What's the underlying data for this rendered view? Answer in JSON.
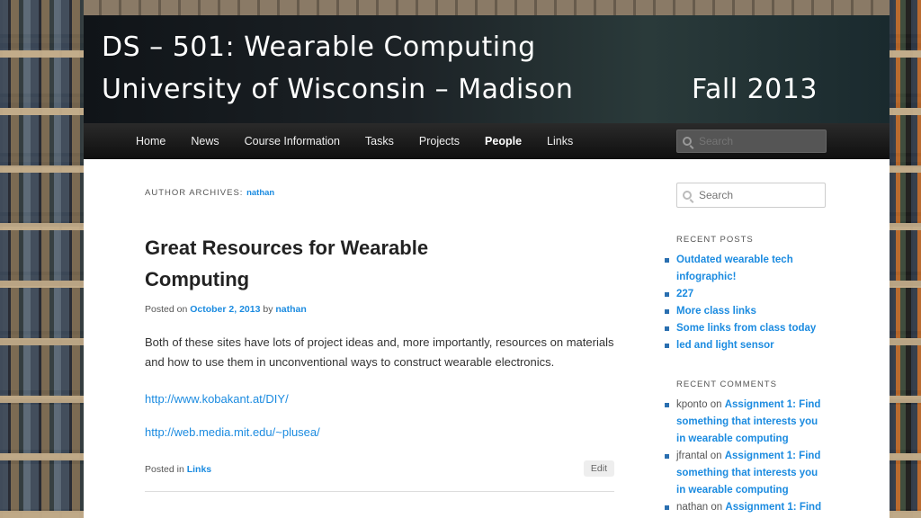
{
  "header": {
    "course": "DS – 501: Wearable Computing",
    "university": "University of Wisconsin – Madison",
    "term": "Fall 2013"
  },
  "nav": {
    "items": [
      "Home",
      "News",
      "Course Information",
      "Tasks",
      "Projects",
      "People",
      "Links"
    ],
    "active": "People",
    "search_placeholder": "Search"
  },
  "archive": {
    "label": "Author Archives:",
    "author": "nathan"
  },
  "post": {
    "title": "Great Resources for Wearable Computing",
    "posted_on_label": "Posted on",
    "date": "October 2, 2013",
    "by_label": "by",
    "author": "nathan",
    "body": "Both of these sites have lots of project ideas and, more importantly, resources on materials and how to use them in unconventional ways to construct wearable electronics.",
    "links": [
      "http://www.kobakant.at/DIY/",
      "http://web.media.mit.edu/~plusea/"
    ],
    "posted_in_label": "Posted in",
    "category": "Links",
    "edit_label": "Edit"
  },
  "sidebar": {
    "search_placeholder": "Search",
    "recent_posts_title": "Recent Posts",
    "recent_posts": [
      "Outdated wearable tech infographic!",
      "227",
      "More class links",
      "Some links from class today",
      "led and light sensor"
    ],
    "recent_comments_title": "Recent Comments",
    "recent_comments": [
      {
        "author": "kponto",
        "on": "on",
        "post": "Assignment 1: Find something that interests you in wearable computing"
      },
      {
        "author": "jfrantal",
        "on": "on",
        "post": "Assignment 1: Find something that interests you in wearable computing"
      },
      {
        "author": "nathan",
        "on": "on",
        "post": "Assignment 1: Find"
      }
    ]
  },
  "colors": {
    "link": "#1b8be0",
    "nav_bg": "#1a1a1a",
    "bullet": "#2a6fb0"
  }
}
